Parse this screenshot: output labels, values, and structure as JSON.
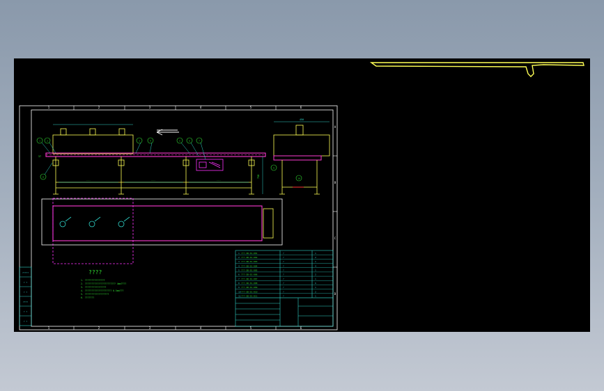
{
  "colors": {
    "viewport_bg": "#000000",
    "frame": "#ffffff",
    "title_block": "#2fd3c8",
    "note_text": "#33e233",
    "dim": "#2fd3c8",
    "conveyor_belt": "#ff3bd2",
    "frame_steel": "#ffff55",
    "callout": "#33e233",
    "magenta": "#ff33ff",
    "red": "#ff3333",
    "stray_polyline": "#ffff55"
  },
  "border": {
    "top_zones": [
      "1",
      "2",
      "3",
      "4",
      "5",
      "6"
    ],
    "bottom_zones": [
      "1",
      "2",
      "3",
      "4",
      "5",
      "6"
    ],
    "side_zones": [
      "A",
      "B",
      "C",
      "D"
    ]
  },
  "front_view": {
    "dim_left": "37",
    "dim_right": "758",
    "callouts": [
      "1",
      "2",
      "3",
      "4",
      "5",
      "6",
      "7",
      "8",
      "9",
      "10",
      "11"
    ]
  },
  "side_view": {
    "dim_top": "450"
  },
  "notes": {
    "heading": "????",
    "lines": [
      "1. ???????????????",
      "2. ??????????????????????? 4mm????",
      "3. ????????????????",
      "4. ???????????????????? 0.5mm???",
      "5. ??????????????????",
      "6. ???????"
    ]
  },
  "title_block": {
    "bom_rows": [
      {
        "no": "1",
        "code": "???-SB-01-001",
        "name": "?",
        "qty": "1"
      },
      {
        "no": "2",
        "code": "???-SB-01-002",
        "name": "?",
        "qty": "2"
      },
      {
        "no": "3",
        "code": "???-SB-01-003",
        "name": "?",
        "qty": "1"
      },
      {
        "no": "4",
        "code": "???-SB-01-004",
        "name": "?",
        "qty": "4"
      },
      {
        "no": "5",
        "code": "???-SB-01-005",
        "name": "?",
        "qty": "1"
      },
      {
        "no": "6",
        "code": "???-SB-01-006",
        "name": "?",
        "qty": "2"
      },
      {
        "no": "7",
        "code": "???-SB-01-007",
        "name": "?",
        "qty": "1"
      },
      {
        "no": "8",
        "code": "???-SB-01-008",
        "name": "?",
        "qty": "6"
      },
      {
        "no": "9",
        "code": "???-SB-01-009",
        "name": "?",
        "qty": "1"
      },
      {
        "no": "10",
        "code": "???-SB-01-010",
        "name": "?",
        "qty": "2"
      },
      {
        "no": "11",
        "code": "???-SB-01-011",
        "name": "?",
        "qty": "1"
      }
    ],
    "side_table": [
      "?????",
      "? ?",
      "? ?",
      "????",
      "? ?",
      "? ?"
    ]
  }
}
